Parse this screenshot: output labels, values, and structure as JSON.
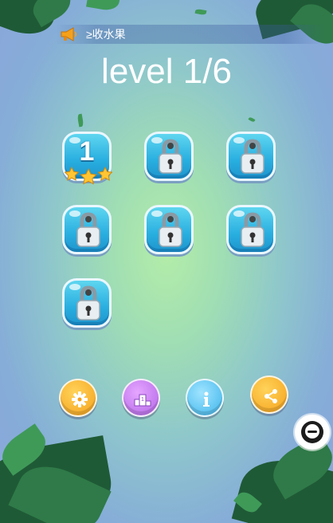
{
  "marquee": {
    "text": "≥收水果",
    "icon": "megaphone-icon"
  },
  "level": {
    "title": "level 1/6",
    "current": 1,
    "total": 6
  },
  "level_tiles": [
    {
      "label": "1",
      "locked": false,
      "stars": 3,
      "icon": "star-icon"
    },
    {
      "locked": true,
      "icon": "padlock-icon"
    },
    {
      "locked": true,
      "icon": "padlock-icon"
    },
    {
      "locked": true,
      "icon": "padlock-icon"
    },
    {
      "locked": true,
      "icon": "padlock-icon"
    },
    {
      "locked": true,
      "icon": "padlock-icon"
    },
    {
      "locked": true,
      "icon": "padlock-icon"
    }
  ],
  "bottom_buttons": [
    {
      "icon": "gear-icon",
      "color": "#f5a11b"
    },
    {
      "icon": "podium-icon",
      "color": "#b165e6"
    },
    {
      "icon": "info-icon",
      "color": "#3db4ea"
    },
    {
      "icon": "share-icon",
      "color": "#f5a11b"
    }
  ],
  "chat_button": {
    "icon": "chat-bubble-icon"
  },
  "colors": {
    "tile": "#28aee0",
    "tile_border": "#eaf7ff",
    "text": "#ffffff",
    "star": "#ffc533"
  }
}
